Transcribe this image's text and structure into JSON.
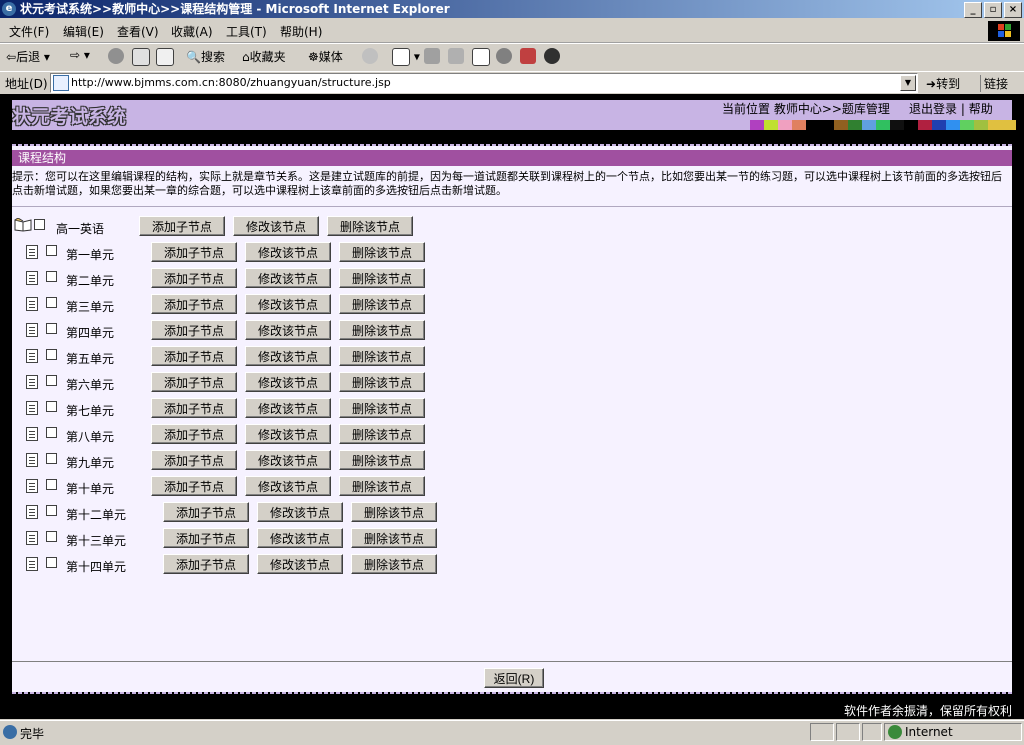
{
  "window": {
    "title": "状元考试系统>>教师中心>>课程结构管理 - Microsoft Internet Explorer",
    "ie_icon": "e",
    "controls": [
      "_",
      "▫",
      "×"
    ]
  },
  "menu": [
    "文件(F)",
    "编辑(E)",
    "查看(V)",
    "收藏(A)",
    "工具(T)",
    "帮助(H)"
  ],
  "toolbar": {
    "back": "后退",
    "search": "搜索",
    "favorites": "收藏夹",
    "media": "媒体"
  },
  "address": {
    "label": "地址(D)",
    "url": "http://www.bjmms.com.cn:8080/zhuangyuan/structure.jsp",
    "go": "转到",
    "links": "链接"
  },
  "header": {
    "logo": "状元考试系统",
    "breadcrumb": "当前位置 教师中心>>题库管理",
    "logout": "退出登录",
    "divider": "|",
    "help": "帮助",
    "swatch_colors": [
      "#b040c0",
      "#c0e030",
      "#f0a0c0",
      "#e08060",
      "#000000",
      "#000000",
      "#906020",
      "#308030",
      "#60a0e0",
      "#30c060",
      "#101010",
      "#000000",
      "#b02040",
      "#2040b0",
      "#3090f0",
      "#60d060",
      "#a0c040",
      "#e0c040",
      "#e0c040"
    ]
  },
  "panel": {
    "title": "课程结构",
    "tip": "提示：您可以在这里编辑课程的结构，实际上就是章节关系。这是建立试题库的前提，因为每一道试题都关联到课程树上的一个节点，比如您要出某一节的练习题，可以选中课程树上该节前面的多选按钮后点击新增试题，如果您要出某一章的综合题，可以选中课程树上该章前面的多选按钮后点击新增试题。"
  },
  "tree": {
    "root": "高一英语",
    "buttons": {
      "add": "添加子节点",
      "edit": "修改该节点",
      "delete": "删除该节点"
    },
    "nodes": [
      "第一单元",
      "第二单元",
      "第三单元",
      "第四单元",
      "第五单元",
      "第六单元",
      "第七单元",
      "第八单元",
      "第九单元",
      "第十单元",
      "第十二单元",
      "第十三单元",
      "第十四单元"
    ]
  },
  "back_button": "返回(R)",
  "footer": "软件作者余振清，保留所有权利",
  "status": {
    "text": "完毕",
    "zone": "Internet"
  }
}
